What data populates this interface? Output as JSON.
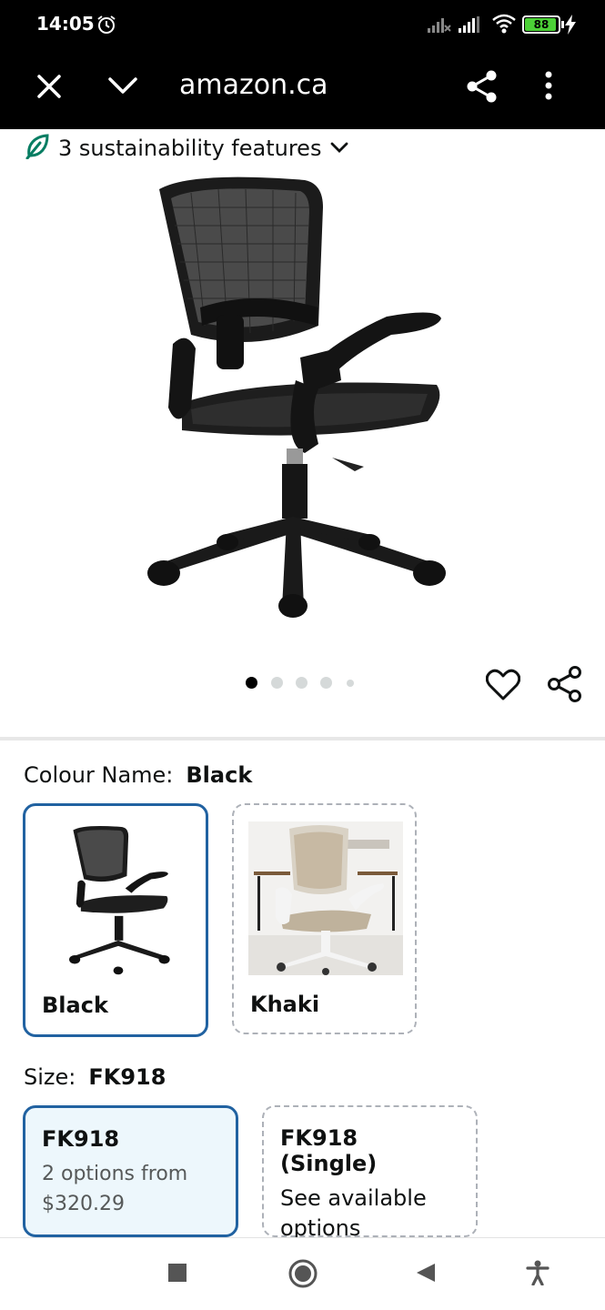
{
  "status_bar": {
    "time": "14:05",
    "battery": "88"
  },
  "browser": {
    "url": "amazon.ca"
  },
  "sustainability": {
    "label": "3 sustainability features"
  },
  "gallery": {
    "dot_count": 5,
    "active_dot": 1
  },
  "colour": {
    "label": "Colour Name:",
    "selected": "Black",
    "options": [
      {
        "name": "Black"
      },
      {
        "name": "Khaki"
      }
    ]
  },
  "size": {
    "label": "Size:",
    "selected": "FK918",
    "options": [
      {
        "title": "FK918",
        "line1": "2 options from",
        "line2": "$320.29"
      },
      {
        "title": "FK918 (Single)",
        "line1": "See available",
        "line2": "options"
      }
    ]
  },
  "colors": {
    "accent_border": "#2162a1",
    "selected_bg": "#edf7fc",
    "leaf": "#067d62"
  },
  "icons": [
    "alarm-icon",
    "signal-icon",
    "wifi-icon",
    "battery-icon",
    "close-icon",
    "chevron-down-icon",
    "share-icon",
    "more-vert-icon",
    "leaf-icon",
    "heart-icon",
    "stop-icon",
    "home-icon",
    "back-icon",
    "accessibility-icon"
  ]
}
